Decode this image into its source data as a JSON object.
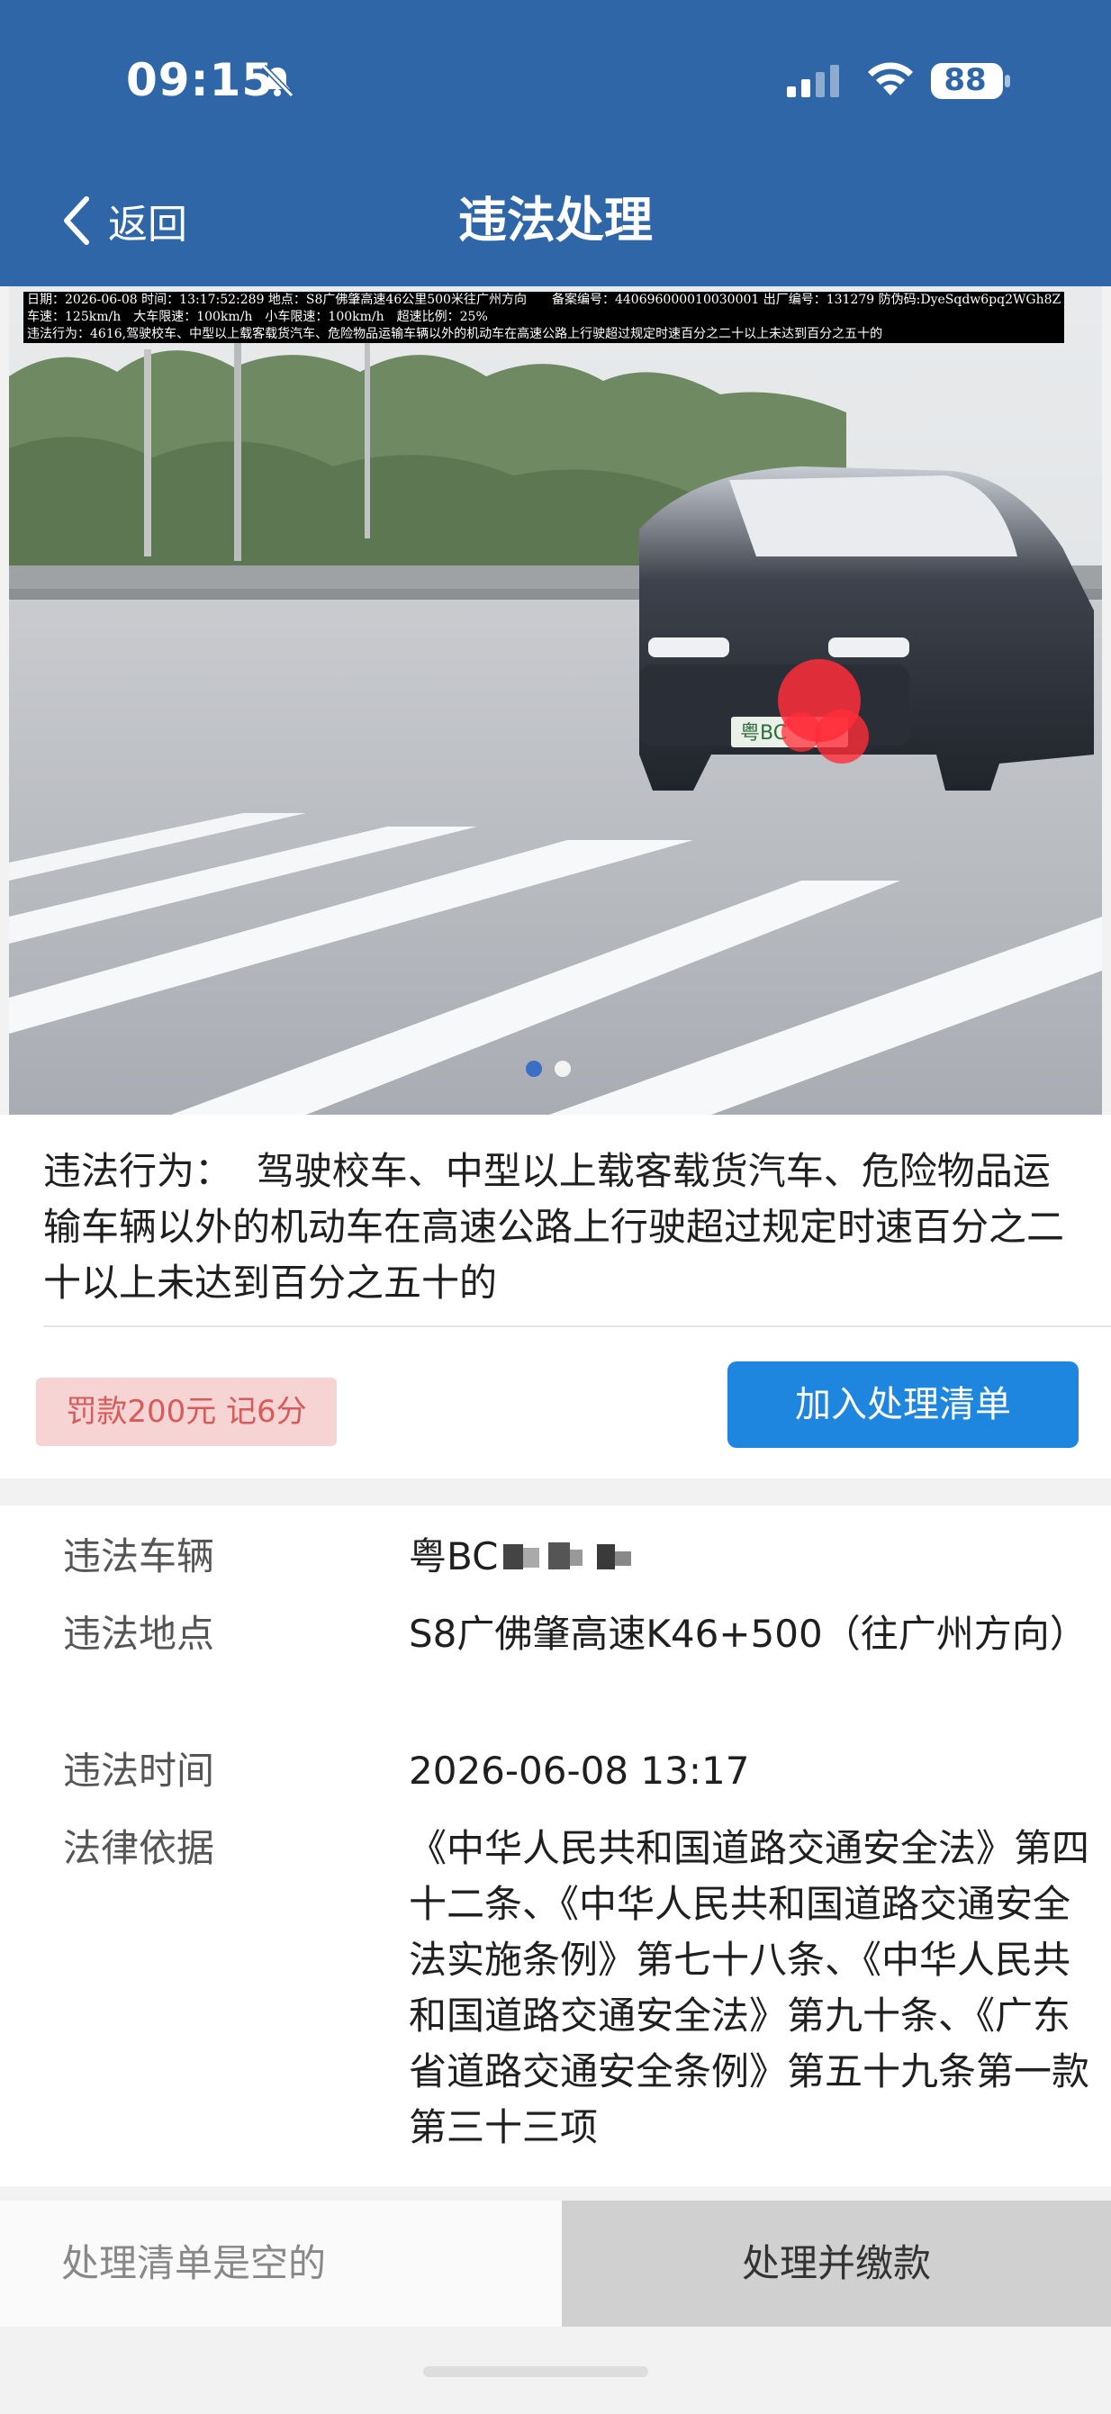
{
  "status_bar": {
    "time": "09:15",
    "battery": "88",
    "icons": [
      "bell-off-icon",
      "signal-icon",
      "wifi-icon",
      "battery-icon"
    ]
  },
  "nav": {
    "back_label": "返回",
    "title": "违法处理"
  },
  "photo": {
    "overlay_lines": [
      "日期：2026-06-08 时间：13:17:52:289 地点：S8广佛肇高速46公里500米往广州方向　　备案编号：440696000010030001 出厂编号：131279 防伪码:DyeSqdw6pq2WGh8Z",
      "车速：125km/h　大车限速：100km/h　小车限速：100km/h　超速比例：25%",
      "违法行为：4616,驾驶校车、中型以上载客载货汽车、危险物品运输车辆以外的机动车在高速公路上行驶超过规定时速百分之二十以上未达到百分之五十的"
    ],
    "plate_prefix": "粤BC",
    "pager": {
      "count": 2,
      "active": 1
    }
  },
  "violation": {
    "behavior_label": "违法行为：",
    "behavior_text": "驾驶校车、中型以上载客载货汽车、危险物品运输车辆以外的机动车在高速公路上行驶超过规定时速百分之二十以上未达到百分之五十的",
    "fine_badge": "罚款200元 记6分",
    "add_button": "加入处理清单"
  },
  "details": {
    "rows": [
      {
        "label": "违法车辆",
        "value": "粤BC"
      },
      {
        "label": "违法地点",
        "value": "S8广佛肇高速K46+500（往广州方向）"
      },
      {
        "label": "违法时间",
        "value": "2026-06-08 13:17"
      },
      {
        "label": "法律依据",
        "value": "《中华人民共和国道路交通安全法》第四十二条、《中华人民共和国道路交通安全法实施条例》第七十八条、《中华人民共和国道路交通安全法》第九十条、《广东省道路交通安全条例》第五十九条第一款第三十三项"
      }
    ]
  },
  "bottom_bar": {
    "empty_text": "处理清单是空的",
    "pay_button": "处理并缴款"
  },
  "colors": {
    "header_blue": "#2f66a8",
    "button_blue": "#1f86e0",
    "fine_badge_bg": "#f7d4d4",
    "fine_badge_text": "#d85a5a",
    "pay_button_bg": "#d0d0d0"
  }
}
